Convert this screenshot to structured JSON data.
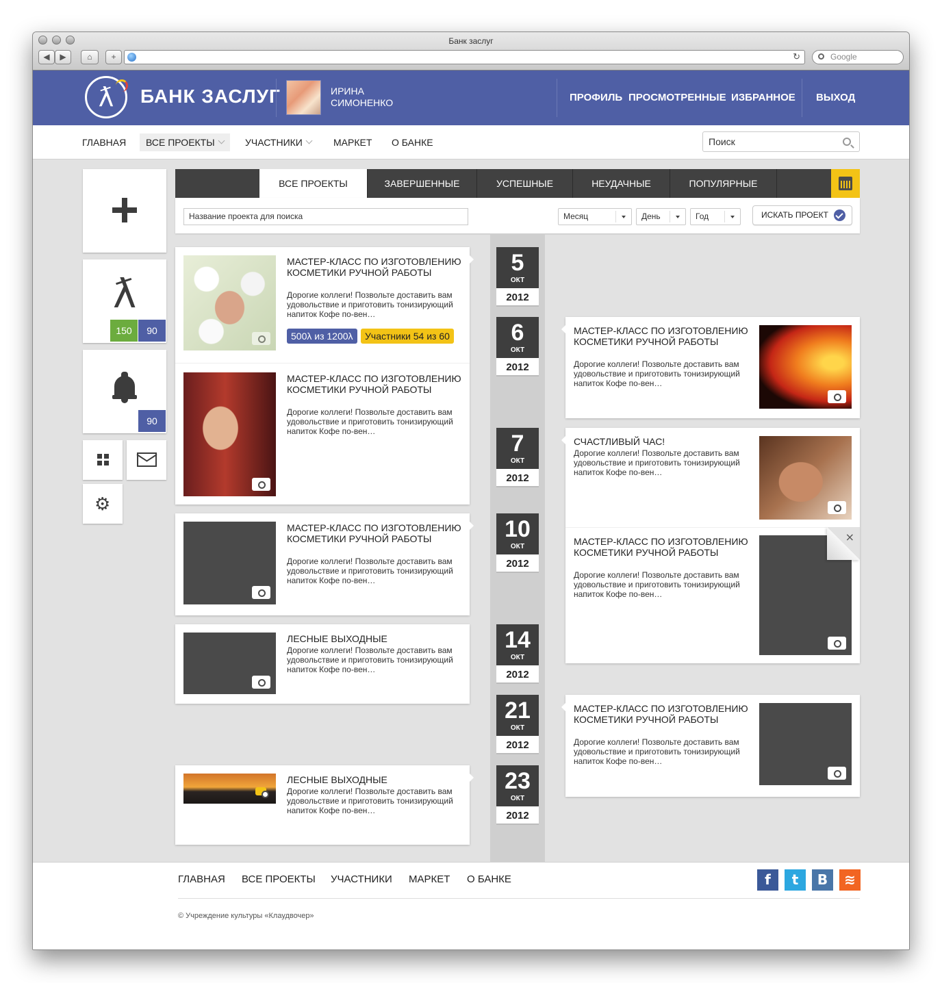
{
  "browser": {
    "window_title": "Банк заслуг",
    "search_placeholder": "Google",
    "back_icon": "◀",
    "forward_icon": "▶",
    "home_icon": "⌂",
    "new_tab_icon": "+",
    "reload_icon": "↻"
  },
  "header": {
    "logo_text": "БАНК ЗАСЛУГ",
    "logo_glyph": "ƛ",
    "user_name": "ИРИНА СИМОНЕНКО",
    "nav": [
      "ПРОФИЛЬ",
      "ПРОСМОТРЕННЫЕ",
      "ИЗБРАННОЕ"
    ],
    "logout": "ВЫХОД",
    "colors": {
      "brand": "#4f5fa5"
    }
  },
  "menu": {
    "items": [
      "ГЛАВНАЯ",
      "ВСЕ ПРОЕКТЫ",
      "УЧАСТНИКИ",
      "МАРКЕТ",
      "О БАНКЕ"
    ],
    "active": "ВСЕ ПРОЕКТЫ",
    "search_placeholder": "Поиск"
  },
  "sidebar": {
    "add_icon": "plus-icon",
    "currency_glyph": "ƛ",
    "balance_green": "150",
    "balance_blue": "90",
    "notifications_count": "90",
    "gear_glyph": "⚙",
    "colors": {
      "green": "#6cac3e",
      "blue": "#4f5fa5"
    }
  },
  "tabs": {
    "items": [
      "ВСЕ ПРОЕКТЫ",
      "ЗАВЕРШЕННЫЕ",
      "УСПЕШНЫЕ",
      "НЕУДАЧНЫЕ",
      "ПОПУЛЯРНЫЕ"
    ],
    "active": "ВСЕ ПРОЕКТЫ",
    "calendar_icon": "calendar-icon"
  },
  "filters": {
    "search_placeholder": "Название проекта для поиска",
    "month": "Месяц",
    "day": "День",
    "year": "Год",
    "submit": "ИСКАТЬ ПРОЕКТ"
  },
  "dates": [
    {
      "day": "5",
      "month": "ОКТ",
      "year": "2012"
    },
    {
      "day": "6",
      "month": "ОКТ",
      "year": "2012"
    },
    {
      "day": "7",
      "month": "ОКТ",
      "year": "2012"
    },
    {
      "day": "10",
      "month": "ОКТ",
      "year": "2012"
    },
    {
      "day": "14",
      "month": "ОКТ",
      "year": "2012"
    },
    {
      "day": "21",
      "month": "ОКТ",
      "year": "2012"
    },
    {
      "day": "23",
      "month": "ОКТ",
      "year": "2012"
    }
  ],
  "left_cards": [
    {
      "title": "Мастер-класс по изготовлению косметики ручной работы",
      "desc": "Дорогие коллеги! Позвольте доставить вам удовольствие и приготовить тонизирующий напиток Кофе по-вен…",
      "badge_points": "500λ из 1200λ",
      "badge_members": "Участники 54 из 60"
    },
    {
      "title": "Мастер-класс по изготовлению косметики ручной работы",
      "desc": "Дорогие коллеги! Позвольте доставить вам удовольствие и приготовить тонизирующий напиток Кофе по-вен…"
    },
    {
      "title": "Мастер-класс по изготовлению косметики ручной работы",
      "desc": "Дорогие коллеги! Позвольте доставить вам удовольствие и приготовить тонизирующий напиток Кофе по-вен…"
    },
    {
      "title": "Лесные выходные",
      "desc": "Дорогие коллеги! Позвольте доставить вам удовольствие и приготовить тонизирующий напиток Кофе по-вен…"
    },
    {
      "title": "Лесные выходные",
      "desc": "Дорогие коллеги! Позвольте доставить вам удовольствие и приготовить тонизирующий напиток Кофе по-вен…"
    }
  ],
  "right_cards": [
    {
      "title": "Мастер-класс по изготовлению косметики ручной работы",
      "desc": "Дорогие коллеги! Позвольте доставить вам удовольствие и приготовить тонизирующий напиток Кофе по-вен…"
    },
    {
      "title": "Счастливый час!",
      "desc": "Дорогие коллеги! Позвольте доставить вам удовольствие и приготовить тонизирующий напиток Кофе по-вен…"
    },
    {
      "title": "Мастер-класс по изготовлению косметики ручной работы",
      "desc": "Дорогие коллеги! Позвольте доставить вам удовольствие и приготовить тонизирующий напиток Кофе по-вен…",
      "close": "×"
    },
    {
      "title": "Мастер-класс по изготовлению косметики ручной работы",
      "desc": "Дорогие коллеги! Позвольте доставить вам удовольствие и приготовить тонизирующий напиток Кофе по-вен…"
    }
  ],
  "footer": {
    "links": [
      "ГЛАВНАЯ",
      "ВСЕ ПРОЕКТЫ",
      "УЧАСТНИКИ",
      "МАРКЕТ",
      "О БАНКЕ"
    ],
    "copyright": "© Учреждение культуры «Клаудвочер»",
    "social": [
      {
        "name": "facebook-icon",
        "glyph": "f",
        "color": "#3b5998"
      },
      {
        "name": "twitter-icon",
        "glyph": "t",
        "color": "#2ca7e0"
      },
      {
        "name": "vk-icon",
        "glyph": "B",
        "color": "#4a76a8"
      },
      {
        "name": "rss-icon",
        "glyph": "≋",
        "color": "#f26522"
      }
    ]
  }
}
